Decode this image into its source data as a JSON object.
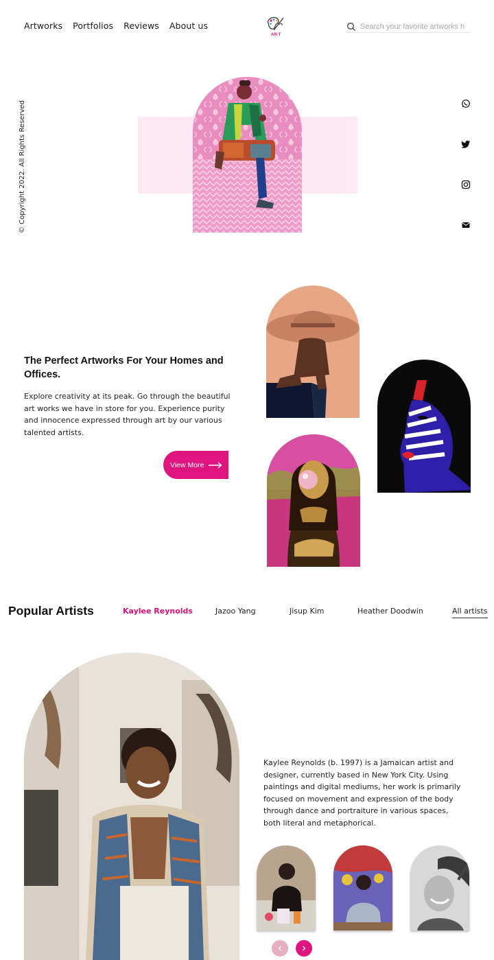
{
  "nav": {
    "items": [
      "Artworks",
      "Portfolios",
      "Reviews",
      "About us"
    ]
  },
  "logo": {
    "text": "AR-T"
  },
  "search": {
    "placeholder": "Search your favorite artworks h"
  },
  "copyright": "© Copyright 2022. All Rights Reserved",
  "social": [
    "whatsapp-icon",
    "twitter-icon",
    "instagram-icon",
    "mail-icon"
  ],
  "section": {
    "title": "The Perfect Artworks For Your Homes and Offices.",
    "text": "Explore creativity at its peak. Go through the beautiful art works we have in store for you. Experience purity and innocence expressed through art by our various talented artists.",
    "button": "View More"
  },
  "popular": {
    "title": "Popular Artists",
    "tabs": [
      "Kaylee Reynolds",
      "Jazoo Yang",
      "Jisup Kim",
      "Heather Doodwin"
    ],
    "active_tab": "Kaylee Reynolds",
    "all_link": "All artists",
    "bio": "Kaylee Reynolds (b. 1997) is a Jamaican artist and designer, currently based in New York City. Using paintings and digital mediums, her work is primarily focused on movement and expression of the body through dance and portraiture in various spaces, both literal and metaphorical."
  },
  "colors": {
    "accent": "#e0147f",
    "accent_light": "#e6aebf",
    "hero_band": "#fbe6f1"
  }
}
